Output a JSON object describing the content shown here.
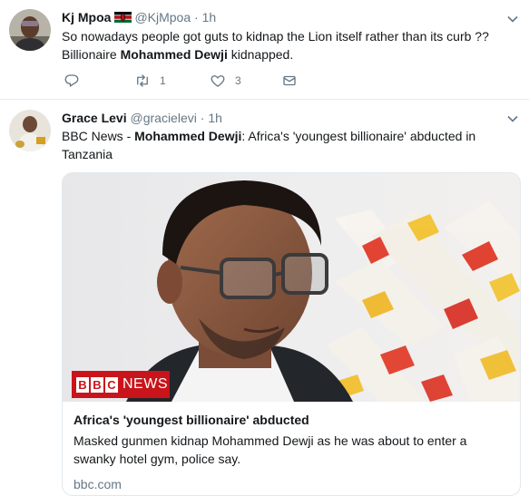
{
  "tweets": [
    {
      "name": "Kj Mpoa",
      "handle": "@KjMpoa",
      "separator": "·",
      "time": "1h",
      "text_1": "So nowadays people got guts to kidnap the Lion itself rather than its curb ??",
      "text_2a": "Billionaire ",
      "text_2b": "Mohammed Dewji",
      "text_2c": " kidnapped.",
      "retweets": "1",
      "likes": "3",
      "flag_icon": "kenya-flag-icon"
    },
    {
      "name": "Grace Levi",
      "handle": "@gracielevi",
      "separator": "·",
      "time": "1h",
      "text_1a": "BBC News - ",
      "text_1b": "Mohammed Dewji",
      "text_1c": ": Africa's 'youngest billionaire' abducted in",
      "text_2": "Tanzania"
    }
  ],
  "card": {
    "title": "Africa's 'youngest billionaire' abducted",
    "description_1": "Masked gunmen kidnap Mohammed Dewji as he was about to enter a",
    "description_2": "swanky hotel gym, police say.",
    "domain": "bbc.com",
    "logo_letters": [
      "B",
      "B",
      "C"
    ],
    "logo_word": "NEWS"
  },
  "colors": {
    "text": "#14171a",
    "muted": "#657786",
    "border": "#e6ecf0",
    "bbc_red": "#c9141b"
  }
}
